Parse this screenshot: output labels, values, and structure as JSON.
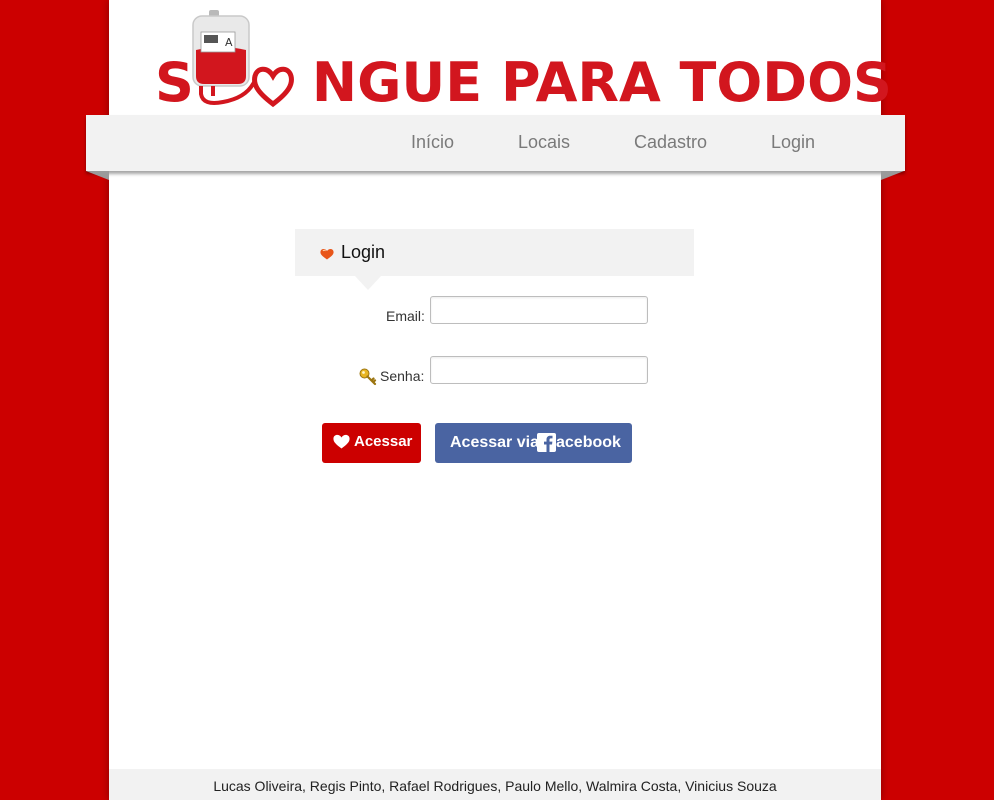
{
  "logo": {
    "text_left": "S",
    "text_right": "NGUE PARA TODOS",
    "bag_letter": "A"
  },
  "nav": {
    "items": [
      {
        "label": "Início"
      },
      {
        "label": "Locais"
      },
      {
        "label": "Cadastro"
      },
      {
        "label": "Login"
      }
    ]
  },
  "login": {
    "title": "Login",
    "email_label": "Email:",
    "email_value": "",
    "password_label": "Senha:",
    "password_value": "",
    "access_button": "Acessar",
    "facebook_button_prefix": "Acessar via ",
    "facebook_button_suffix": "acebook"
  },
  "footer": {
    "line1": "Lucas Oliveira, Regis Pinto, Rafael Rodrigues, Paulo Mello, Walmira Costa, Vinicius Souza"
  },
  "colors": {
    "brand_red": "#cc0000",
    "logo_red": "#d2161e",
    "facebook_blue": "#4a64a2",
    "panel_gray": "#f2f2f2"
  }
}
